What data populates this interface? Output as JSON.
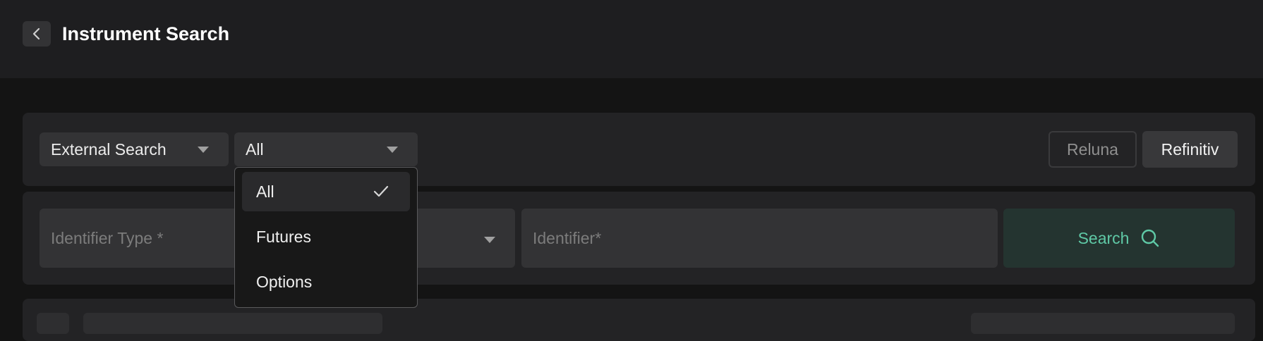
{
  "header": {
    "title": "Instrument Search",
    "back_icon": "chevron-left-icon"
  },
  "filters": {
    "search_mode": "External Search",
    "instrument_type": "All",
    "instrument_type_options": [
      {
        "label": "All",
        "selected": true
      },
      {
        "label": "Futures",
        "selected": false
      },
      {
        "label": "Options",
        "selected": false
      }
    ],
    "sources": [
      {
        "label": "Reluna",
        "active": false
      },
      {
        "label": "Refinitiv",
        "active": true
      }
    ]
  },
  "search_form": {
    "identifier_type_placeholder": "Identifier Type *",
    "identifier_placeholder": "Identifier*",
    "search_label": "Search",
    "search_icon": "search-icon"
  },
  "colors": {
    "background": "#141414",
    "header": "#1e1e20",
    "panel": "#232325",
    "control": "#333335",
    "accent": "#5fc9a6",
    "accent_bg": "#243430"
  }
}
